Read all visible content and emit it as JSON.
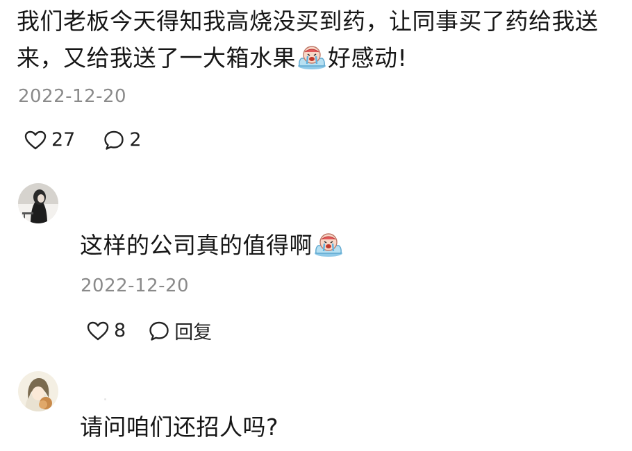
{
  "main_comment": {
    "text_part1": "我们老板今天得知我高烧没买到药，让同事买了药给我送来，又给我送了一大箱水果",
    "text_part2": "好感动!",
    "date": "2022-12-20",
    "like_count": "27",
    "comment_count": "2",
    "emoji": "crying-face-emoji"
  },
  "reply1": {
    "text": "这样的公司真的值得啊",
    "date": "2022-12-20",
    "like_count": "8",
    "reply_label": "回复",
    "emoji": "crying-face-emoji"
  },
  "reply2": {
    "text": "请问咱们还招人吗?"
  },
  "colors": {
    "text": "#161616",
    "date": "#8a8a8a",
    "emoji_blue": "#8fc9e8",
    "emoji_pink": "#f2b5b5"
  },
  "icons": [
    "heart-icon",
    "comment-bubble-icon",
    "avatar"
  ]
}
